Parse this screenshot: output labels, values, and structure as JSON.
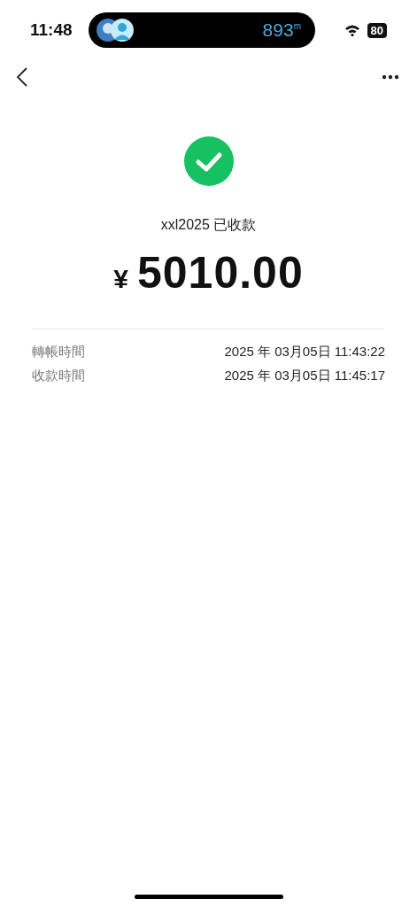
{
  "status_bar": {
    "time": "11:48",
    "island": {
      "distance": "893",
      "unit": "m"
    },
    "battery": "80"
  },
  "payment": {
    "payee_status": "xxl2025 已收款",
    "currency": "¥",
    "amount": "5010.00"
  },
  "details": [
    {
      "label": "轉帳時間",
      "value": "2025 年 03月05日 11:43:22"
    },
    {
      "label": "收款時間",
      "value": "2025 年 03月05日 11:45:17"
    }
  ]
}
